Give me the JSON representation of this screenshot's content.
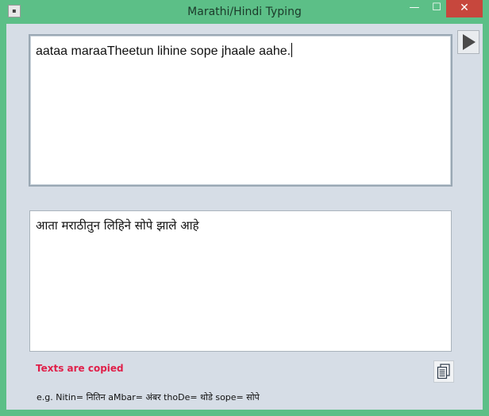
{
  "window": {
    "title": "Marathi/Hindi Typing",
    "minimize_glyph": "—",
    "maximize_glyph": "☐",
    "close_glyph": "✕",
    "system_icon": "app-menu-icon"
  },
  "input": {
    "value": "aataa maraaTheetun lihine sope jhaale aahe."
  },
  "output": {
    "value": "आता मराठीतुन लिहिने सोपे झाले आहे"
  },
  "status": {
    "text": "Texts are copied",
    "color": "#e0204a"
  },
  "icons": {
    "play": "play-triangle-icon",
    "copy": "copy-document-icon"
  },
  "footer": {
    "example": "e.g. Nitin= नितिन  aMbar= अंबर  thoDe= थोडे  sope= सोपे"
  },
  "colors": {
    "titlebar": "#5cbf87",
    "close": "#c7473d",
    "client": "#d6dde6"
  }
}
